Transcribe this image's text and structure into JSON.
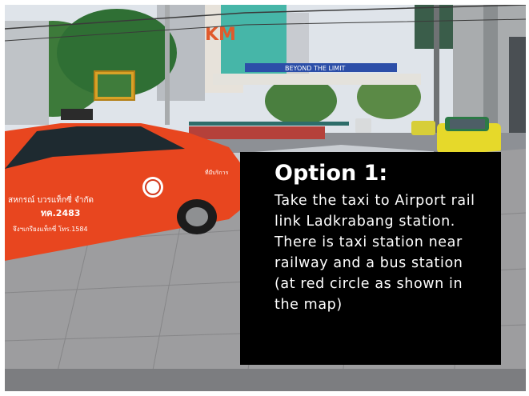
{
  "caption": {
    "title": "Option 1:",
    "body": "Take the taxi to Airport rail link Ladkrabang station. There is taxi station near railway and a bus station (at red circle as shown in the map)"
  },
  "scene": {
    "banner_text": "BEYOND THE LIMIT",
    "building_sign": "KM",
    "taxi_door_text_line1": "สหกรณ์ บวรแท็กซี่ จำกัด",
    "taxi_door_text_line2": "ทค.2483",
    "taxi_door_text_line3": "จึงฯเกรียงแท็กซี่ โทร.1584",
    "taxi_rear_text": "ที่มีบริการ"
  },
  "colors": {
    "taxi": "#e8461f",
    "yellow_taxi": "#e6d92a",
    "caption_bg": "#000000",
    "caption_text": "#ffffff"
  }
}
